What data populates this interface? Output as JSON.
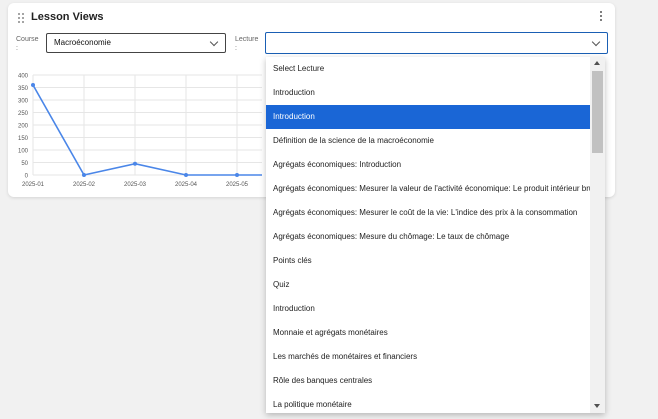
{
  "card": {
    "title": "Lesson Views",
    "course_label": "Course",
    "course_value": "Macroéconomie",
    "lecture_label": "Lecture",
    "lecture_value": ""
  },
  "dropdown": {
    "options": [
      "Select Lecture",
      "Introduction",
      "Introduction",
      "Définition de la science de la macroéconomie",
      "Agrégats économiques: Introduction",
      "Agrégats économiques: Mesurer la valeur de l'activité économique: Le produit intérieur brut",
      "Agrégats économiques: Mesurer le coût de la vie: L'indice des prix à la consommation",
      "Agrégats économiques: Mesure du chômage: Le taux de chômage",
      "Points clés",
      "Quiz",
      "Introduction",
      "Monnaie et agrégats monétaires",
      "Les marchés de monétaires et financiers",
      "Rôle des banques centrales",
      "La politique monétaire"
    ],
    "selected_index": 2
  },
  "chart_data": {
    "type": "line",
    "categories": [
      "2025-01",
      "2025-02",
      "2025-03",
      "2025-04",
      "2025-05"
    ],
    "values": [
      360,
      0,
      45,
      0,
      0
    ],
    "y_ticks": [
      0,
      50,
      100,
      150,
      200,
      250,
      300,
      350,
      400
    ],
    "ylim": [
      0,
      400
    ],
    "grid": true,
    "color": "#4a86e8"
  }
}
